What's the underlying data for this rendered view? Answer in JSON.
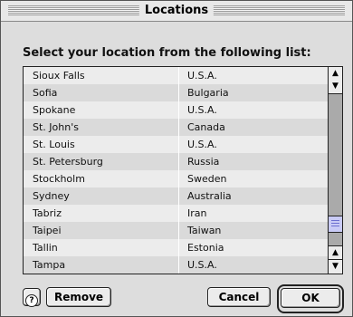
{
  "window": {
    "title": "Locations"
  },
  "prompt": "Select your location from the following list:",
  "locations": [
    {
      "city": "Sioux Falls",
      "country": "U.S.A."
    },
    {
      "city": "Sofia",
      "country": "Bulgaria"
    },
    {
      "city": "Spokane",
      "country": "U.S.A."
    },
    {
      "city": "St. John's",
      "country": "Canada"
    },
    {
      "city": "St. Louis",
      "country": "U.S.A."
    },
    {
      "city": "St. Petersburg",
      "country": "Russia"
    },
    {
      "city": "Stockholm",
      "country": "Sweden"
    },
    {
      "city": "Sydney",
      "country": "Australia"
    },
    {
      "city": "Tabriz",
      "country": "Iran"
    },
    {
      "city": "Taipei",
      "country": "Taiwan"
    },
    {
      "city": "Tallin",
      "country": "Estonia"
    },
    {
      "city": "Tampa",
      "country": "U.S.A."
    }
  ],
  "scrollbar": {
    "up_glyph": "▲",
    "down_glyph": "▼"
  },
  "buttons": {
    "help_glyph": "?",
    "remove": "Remove",
    "cancel": "Cancel",
    "ok": "OK"
  },
  "colors": {
    "scroll_thumb": "#c9cbf6",
    "scroll_track": "#aaaaaa"
  }
}
